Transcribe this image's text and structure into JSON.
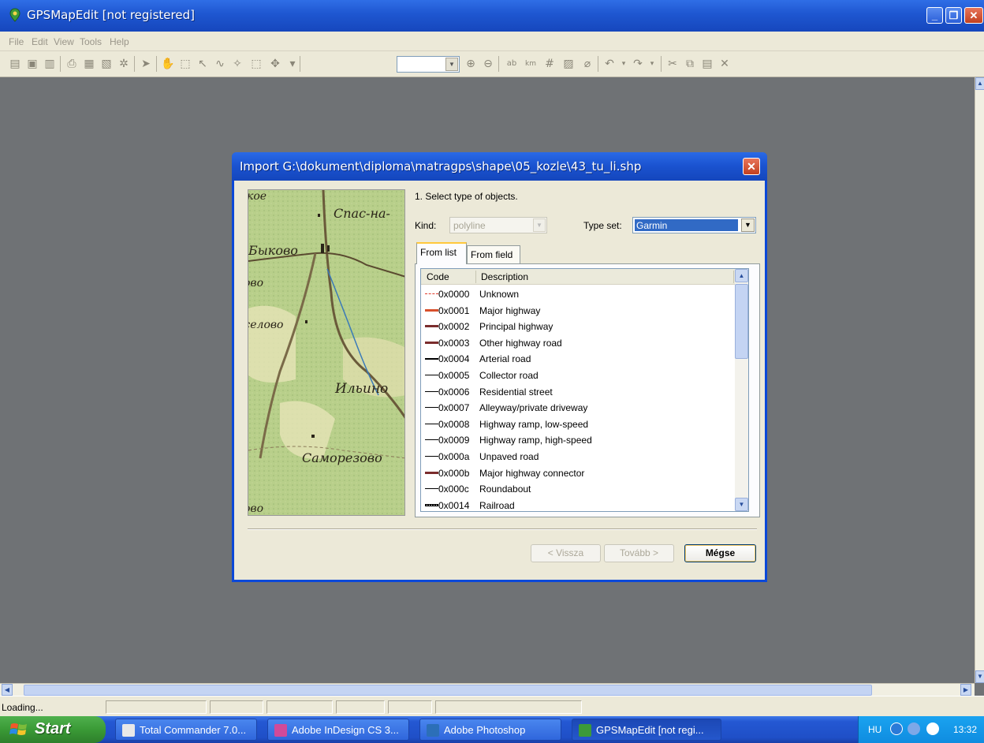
{
  "window": {
    "title": "GPSMapEdit [not registered]"
  },
  "menu": [
    "File",
    "Edit",
    "View",
    "Tools",
    "Help"
  ],
  "dialog": {
    "title": "Import G:\\dokument\\diploma\\matragps\\shape\\05_kozle\\43_tu_li.shp",
    "step": "1. Select type of objects.",
    "kind_label": "Kind:",
    "kind_value": "polyline",
    "typeset_label": "Type set:",
    "typeset_value": "Garmin",
    "tabs": [
      "From list",
      "From field"
    ],
    "columns": [
      "Code",
      "Description"
    ],
    "rows": [
      {
        "code": "0x0000",
        "desc": "Unknown",
        "color": "#e03c2c",
        "style": "dashed"
      },
      {
        "code": "0x0001",
        "desc": "Major highway",
        "color": "#d8502c",
        "style": "thick"
      },
      {
        "code": "0x0002",
        "desc": "Principal highway",
        "color": "#7a2c2c",
        "style": "thick"
      },
      {
        "code": "0x0003",
        "desc": "Other highway road",
        "color": "#7a2c2c",
        "style": "thick"
      },
      {
        "code": "0x0004",
        "desc": "Arterial road",
        "color": "#000000",
        "style": "medium"
      },
      {
        "code": "0x0005",
        "desc": "Collector road",
        "color": "#000000",
        "style": "thin"
      },
      {
        "code": "0x0006",
        "desc": "Residential street",
        "color": "#000000",
        "style": "thin"
      },
      {
        "code": "0x0007",
        "desc": "Alleyway/private driveway",
        "color": "#000000",
        "style": "thin"
      },
      {
        "code": "0x0008",
        "desc": "Highway ramp, low-speed",
        "color": "#000000",
        "style": "thin"
      },
      {
        "code": "0x0009",
        "desc": "Highway ramp, high-speed",
        "color": "#000000",
        "style": "thin"
      },
      {
        "code": "0x000a",
        "desc": "Unpaved road",
        "color": "#000000",
        "style": "thin"
      },
      {
        "code": "0x000b",
        "desc": "Major highway connector",
        "color": "#7a2c2c",
        "style": "thick"
      },
      {
        "code": "0x000c",
        "desc": "Roundabout",
        "color": "#000000",
        "style": "thin"
      },
      {
        "code": "0x0014",
        "desc": "Railroad",
        "color": "#000000",
        "style": "rail"
      }
    ],
    "buttons": {
      "back": "< Vissza",
      "next": "Tovább >",
      "cancel": "Mégse"
    },
    "map_labels": [
      "Спас-на-",
      "Быково",
      "ово",
      "оселово",
      "Ильино",
      "Саморезово",
      "ово",
      "кое"
    ]
  },
  "status": {
    "text": "Loading..."
  },
  "taskbar": {
    "start": "Start",
    "tasks": [
      "Total Commander 7.0...",
      "Adobe InDesign CS 3...",
      "Adobe Photoshop",
      "GPSMapEdit [not regi..."
    ],
    "lang": "HU",
    "clock": "13:32"
  }
}
